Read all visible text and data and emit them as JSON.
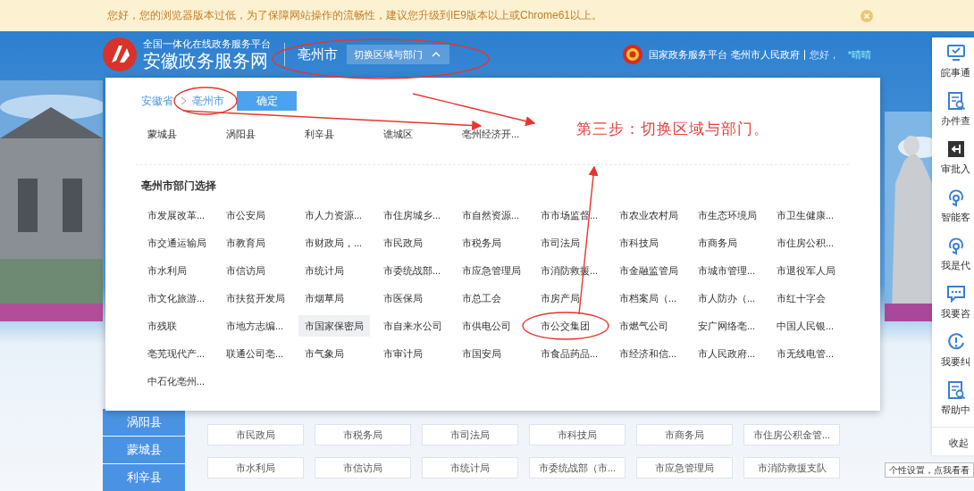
{
  "notice": {
    "text": "您好，您的浏览器版本过低，为了保障网站操作的流畅性，建议您升级到IE9版本以上或Chrome61以上。"
  },
  "header": {
    "subtitle": "全国一体化在线政务服务平台",
    "title": "安徽政务服务网",
    "city": "亳州市",
    "switch_button": "切换区域与部门",
    "expanded": true,
    "platform_link": "国家政务服务平台",
    "government_link": "亳州市人民政府",
    "greeting": "您好，",
    "user": "*晴晴"
  },
  "picker": {
    "breadcrumb": [
      "安徽省",
      "亳州市"
    ],
    "confirm_button": "确定",
    "regions": [
      "蒙城县",
      "涡阳县",
      "利辛县",
      "谯城区",
      "亳州经济开..."
    ],
    "department_heading": "亳州市部门选择",
    "departments": [
      {
        "name": "市发展改革...",
        "highlighted": false
      },
      {
        "name": "市公安局",
        "highlighted": false
      },
      {
        "name": "市人力资源...",
        "highlighted": false
      },
      {
        "name": "市住房城乡...",
        "highlighted": false
      },
      {
        "name": "市自然资源...",
        "highlighted": false
      },
      {
        "name": "市市场监督...",
        "highlighted": false
      },
      {
        "name": "市农业农村局",
        "highlighted": false
      },
      {
        "name": "市生态环境局",
        "highlighted": false
      },
      {
        "name": "市卫生健康...",
        "highlighted": false
      },
      {
        "name": "市交通运输局",
        "highlighted": false
      },
      {
        "name": "市教育局",
        "highlighted": false
      },
      {
        "name": "市财政局，...",
        "highlighted": false
      },
      {
        "name": "市民政局",
        "highlighted": false
      },
      {
        "name": "市税务局",
        "highlighted": false
      },
      {
        "name": "市司法局",
        "highlighted": false
      },
      {
        "name": "市科技局",
        "highlighted": false
      },
      {
        "name": "市商务局",
        "highlighted": false
      },
      {
        "name": "市住房公积...",
        "highlighted": false
      },
      {
        "name": "市水利局",
        "highlighted": false
      },
      {
        "name": "市信访局",
        "highlighted": false
      },
      {
        "name": "市统计局",
        "highlighted": false
      },
      {
        "name": "市委统战部...",
        "highlighted": false
      },
      {
        "name": "市应急管理局",
        "highlighted": false
      },
      {
        "name": "市消防救援...",
        "highlighted": false
      },
      {
        "name": "市金融监管局",
        "highlighted": false
      },
      {
        "name": "市城市管理...",
        "highlighted": false
      },
      {
        "name": "市退役军人局",
        "highlighted": false
      },
      {
        "name": "市文化旅游...",
        "highlighted": false
      },
      {
        "name": "市扶贫开发局",
        "highlighted": false
      },
      {
        "name": "市烟草局",
        "highlighted": false
      },
      {
        "name": "市医保局",
        "highlighted": false
      },
      {
        "name": "市总工会",
        "highlighted": false
      },
      {
        "name": "市房产局",
        "highlighted": false
      },
      {
        "name": "市档案局（...",
        "highlighted": false
      },
      {
        "name": "市人防办（...",
        "highlighted": false
      },
      {
        "name": "市红十字会",
        "highlighted": false
      },
      {
        "name": "市残联",
        "highlighted": false
      },
      {
        "name": "市地方志编...",
        "highlighted": false
      },
      {
        "name": "市国家保密局",
        "highlighted": true
      },
      {
        "name": "市自来水公司",
        "highlighted": false
      },
      {
        "name": "市供电公司",
        "highlighted": false
      },
      {
        "name": "市公交集团",
        "highlighted": false
      },
      {
        "name": "市燃气公司",
        "highlighted": false
      },
      {
        "name": "安广网络亳...",
        "highlighted": false
      },
      {
        "name": "中国人民银...",
        "highlighted": false
      },
      {
        "name": "亳芜现代产...",
        "highlighted": false
      },
      {
        "name": "联通公司亳...",
        "highlighted": false
      },
      {
        "name": "市气象局",
        "highlighted": false
      },
      {
        "name": "市审计局",
        "highlighted": false
      },
      {
        "name": "市国安局",
        "highlighted": false
      },
      {
        "name": "市食品药品...",
        "highlighted": false
      },
      {
        "name": "市经济和信...",
        "highlighted": false
      },
      {
        "name": "市人民政府...",
        "highlighted": false
      },
      {
        "name": "市无线电管...",
        "highlighted": false
      },
      {
        "name": "中石化亳州...",
        "highlighted": false
      }
    ]
  },
  "background_page": {
    "districts": [
      "涡阳县",
      "蒙城县",
      "利辛县"
    ],
    "departments": [
      "市民政局",
      "市税务局",
      "市司法局",
      "市科技局",
      "市商务局",
      "市住房公积金管...",
      "市水利局",
      "市信访局",
      "市统计局",
      "市委统战部（市...",
      "市应急管理局",
      "市消防救援支队"
    ]
  },
  "side_menu": {
    "items": [
      "皖事通",
      "办件查",
      "审批入",
      "智能客",
      "我是代",
      "我要咨",
      "我要纠",
      "帮助中"
    ],
    "collapse": "收起"
  },
  "tooltip": "个性设置，点我看看",
  "annotation": {
    "text": "第三步：切换区域与部门。"
  }
}
